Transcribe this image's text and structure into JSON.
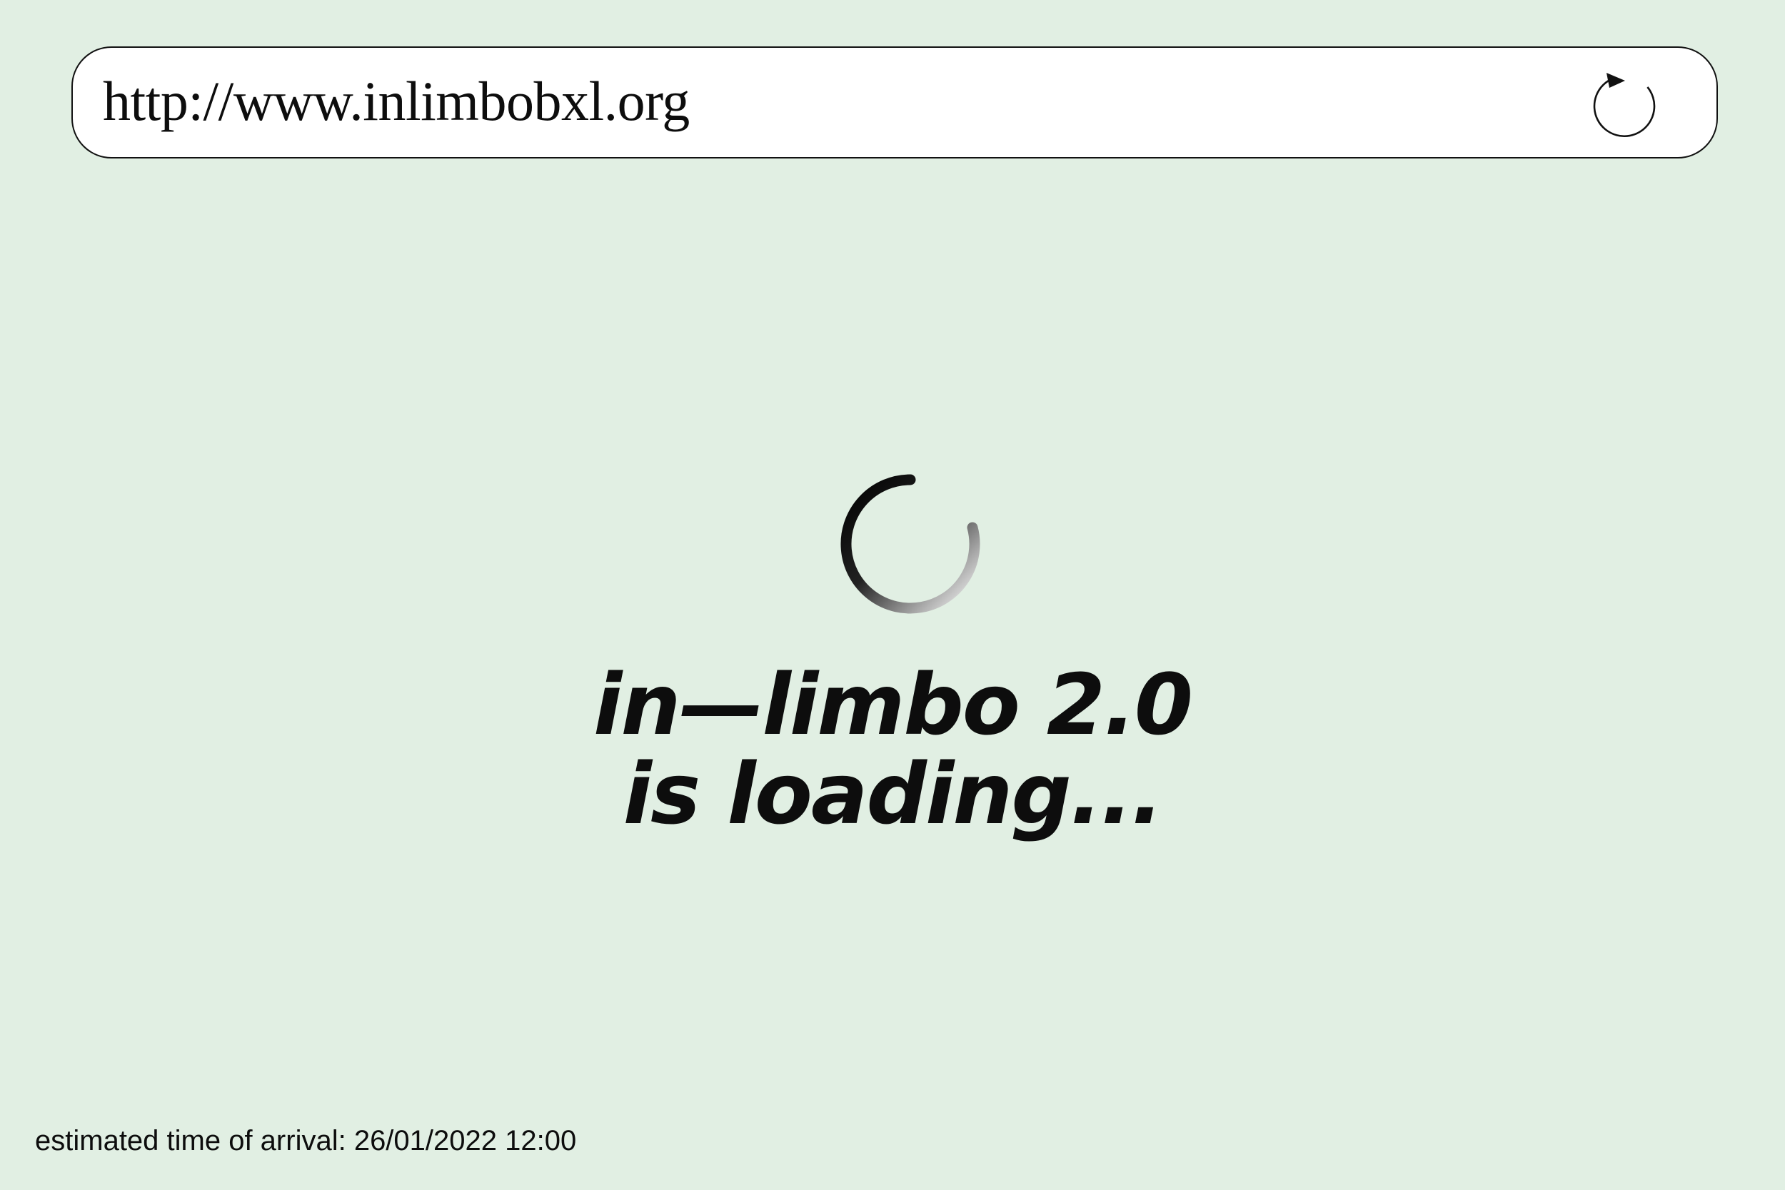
{
  "address_bar": {
    "url": "http://www.inlimbobxl.org",
    "reload_icon": "reload-icon"
  },
  "loader": {
    "spinner_icon": "loading-spinner-icon",
    "title_line_1": "in—limbo 2.0",
    "title_line_2": "is loading..."
  },
  "footer": {
    "eta": "estimated time of arrival: 26/01/2022 12:00"
  },
  "colors": {
    "background": "#e1efe3",
    "text": "#0d0d0d",
    "address_bar_background": "#ffffff"
  }
}
